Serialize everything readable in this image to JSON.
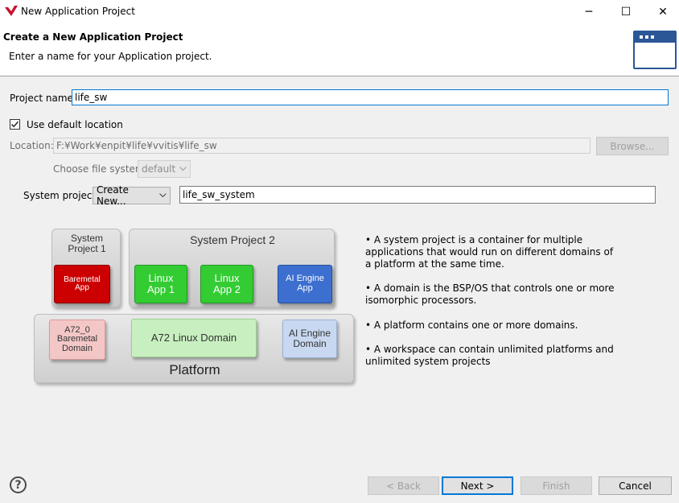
{
  "window": {
    "title": "New Application Project",
    "minimize_glyph": "─",
    "maximize_glyph": "☐",
    "close_glyph": "✕"
  },
  "banner": {
    "title": "Create a New Application Project",
    "subtitle": "Enter a name for your Application project.",
    "icon": "window-icon"
  },
  "form": {
    "project_name_label": "Project name:",
    "project_name_value": "life_sw",
    "use_default_label": "Use default location",
    "use_default_checked": true,
    "location_label": "Location:",
    "location_value": "F:¥Work¥enpit¥life¥vvitis¥life_sw",
    "browse_label": "Browse...",
    "file_system_label": "Choose file system:",
    "file_system_value": "default",
    "system_project_label": "System project:",
    "system_project_select": "Create New...",
    "system_project_name": "life_sw_system"
  },
  "diagram": {
    "system_project_1": "System\nProject 1",
    "system_project_2": "System Project 2",
    "baremetal_app": "Baremetal\nApp",
    "linux_app_1": "Linux\nApp 1",
    "linux_app_2": "Linux\nApp 2",
    "ai_engine_app": "AI Engine\nApp",
    "a72_baremetal": "A72_0\nBaremetal\nDomain",
    "a72_linux": "A72 Linux Domain",
    "ai_engine_domain": "AI Engine\nDomain",
    "platform": "Platform",
    "colors": {
      "baremetal_app": "#cc0000",
      "linux_app": "#33cc33",
      "ai_engine_app": "#3c6fcf",
      "baremetal_domain": "#f4c7c7",
      "linux_domain": "#c8efc0",
      "ai_domain": "#c8d8f0"
    }
  },
  "bullets": [
    "• A system project is a container for multiple applications that would run on different domains of a platform at the same time.",
    "• A domain is the BSP/OS that controls one or more isomorphic processors.",
    "• A platform contains one or more domains.",
    "• A workspace can contain unlimited platforms and unlimited system projects"
  ],
  "footer": {
    "help_icon": "help-icon",
    "help_glyph": "?",
    "back_label": "< Back",
    "next_label": "Next >",
    "finish_label": "Finish",
    "cancel_label": "Cancel"
  }
}
